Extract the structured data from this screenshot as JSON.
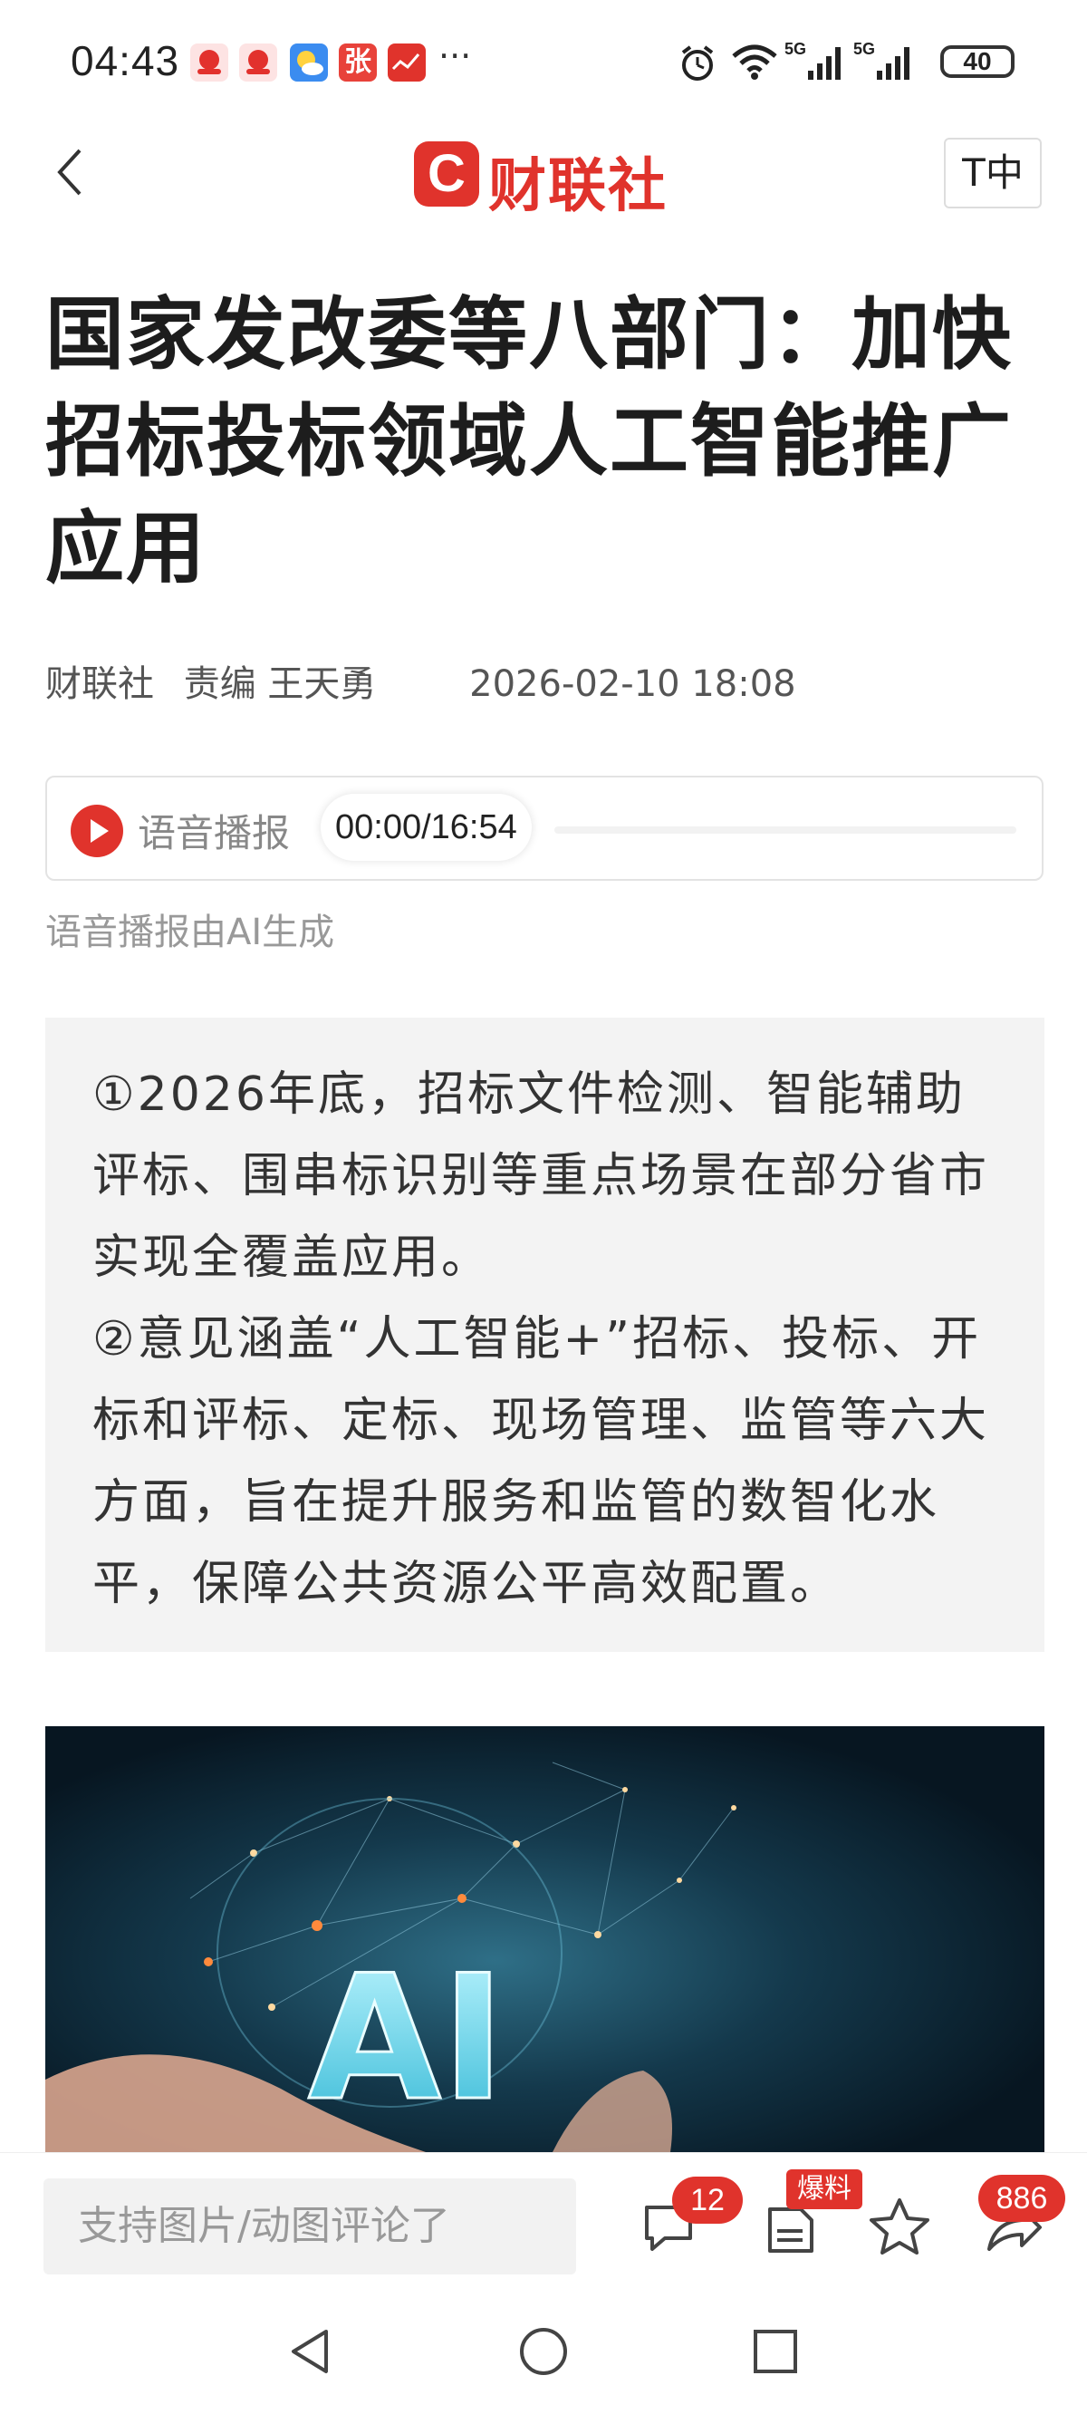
{
  "status_bar": {
    "time": "04:43",
    "battery": "40",
    "more": "···",
    "notification_icons": [
      "pinduoduo-icon",
      "pinduoduo-icon",
      "weather-icon",
      "zhang-app-icon",
      "chart-app-icon"
    ],
    "system_icons": [
      "alarm-icon",
      "wifi-icon",
      "signal-5g-icon",
      "signal-5g-icon",
      "battery-icon"
    ],
    "zhang_glyph": "张"
  },
  "header": {
    "brand": "财联社",
    "logo_letter": "C",
    "font_size_button": "T中"
  },
  "article": {
    "title": "国家发改委等八部门：加快招标投标领域人工智能推广应用",
    "source": "财联社",
    "editor": "责编 王天勇",
    "datetime": "2026-02-10 18:08"
  },
  "audio": {
    "label": "语音播报",
    "timer": "00:00/16:54",
    "progress": 0,
    "note": "语音播报由AI生成"
  },
  "summary": {
    "point1": "①2026年底，招标文件检测、智能辅助评标、围串标识别等重点场景在部分省市实现全覆盖应用。",
    "point2": "②意见涵盖“人工智能+”招标、投标、开标和评标、定标、现场管理、监管等六大方面，旨在提升服务和监管的数智化水平，保障公共资源公平高效配置。"
  },
  "hero_image": {
    "text": "AI"
  },
  "bottom_bar": {
    "comment_placeholder": "支持图片/动图评论了",
    "comment_count": "12",
    "tip_badge": "爆料",
    "share_count": "886"
  },
  "colors": {
    "brand_red": "#e0332c",
    "text_dark": "#1d1d1d",
    "summary_bg": "#f3f3f3"
  }
}
